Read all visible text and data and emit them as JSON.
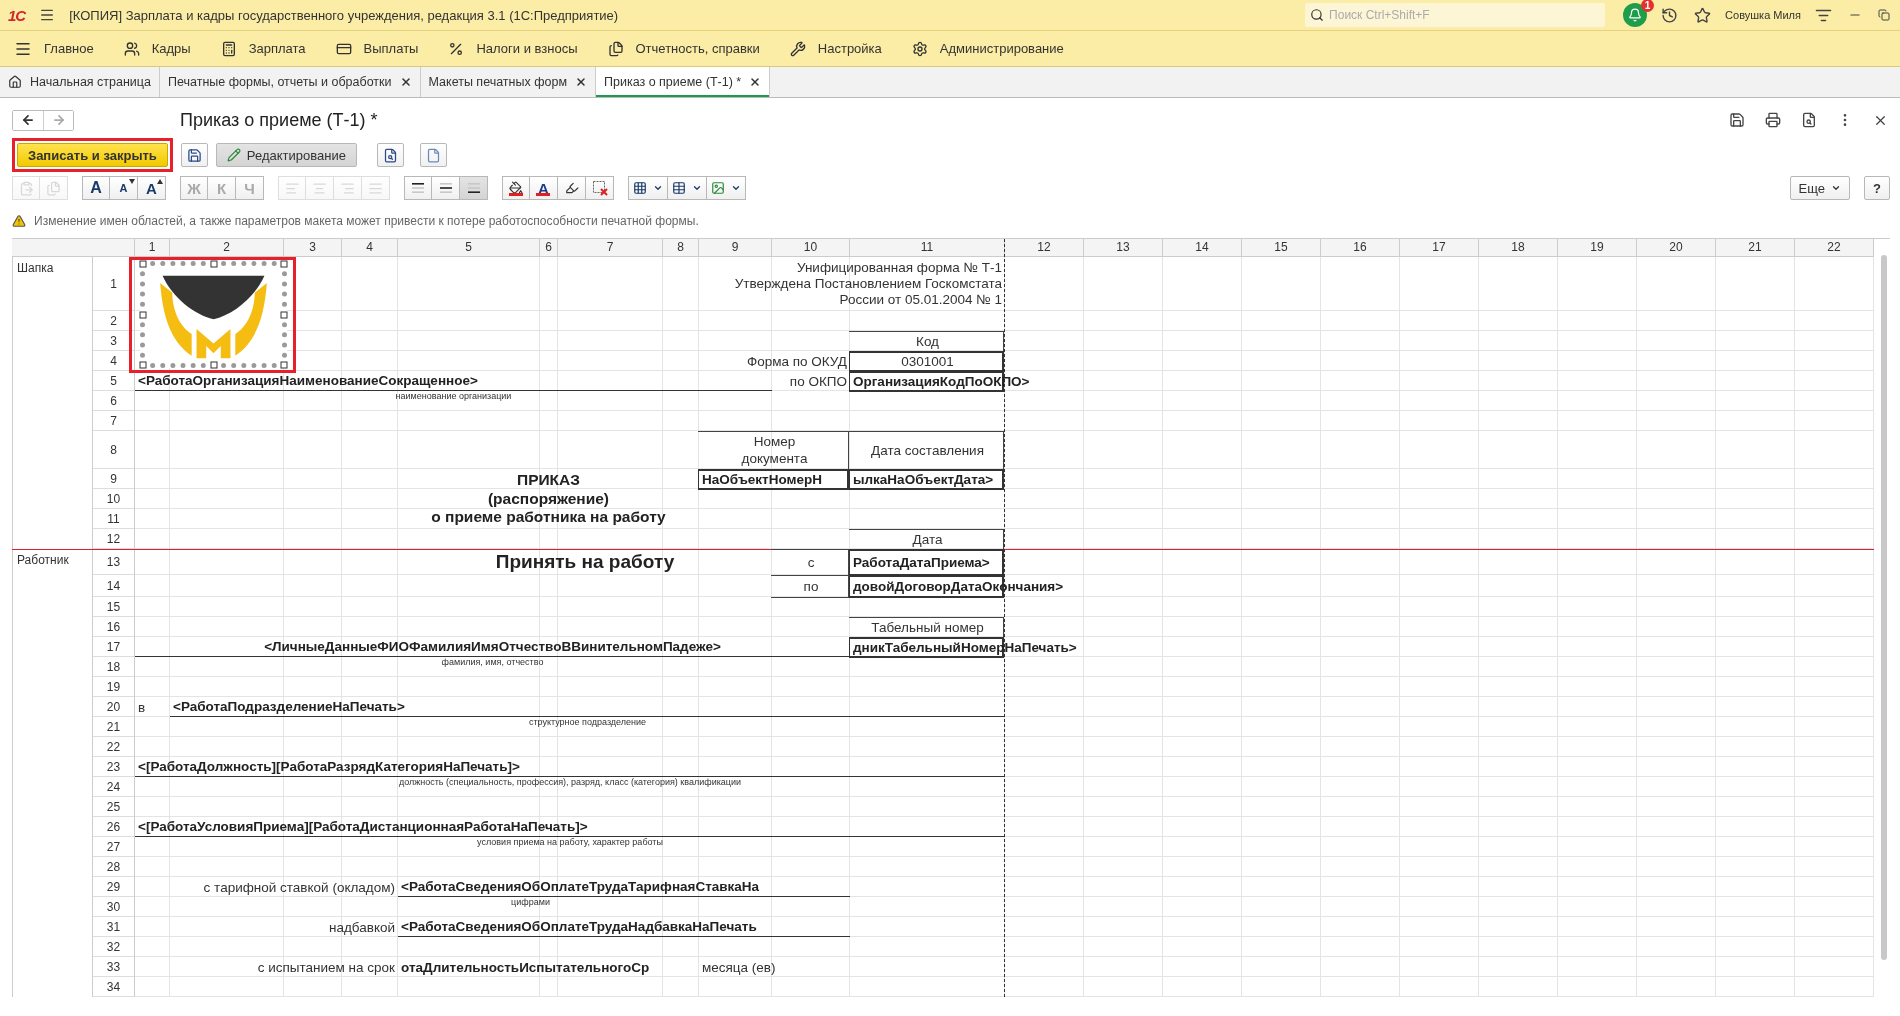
{
  "title_bar": {
    "logo": "1С",
    "title": "[КОПИЯ] Зарплата и кадры государственного учреждения, редакция 3.1  (1С:Предприятие)",
    "search_placeholder": "Поиск Ctrl+Shift+F",
    "notification_count": "1",
    "user": "Совушка Миля"
  },
  "sections": [
    {
      "label": "Главное"
    },
    {
      "label": "Кадры"
    },
    {
      "label": "Зарплата"
    },
    {
      "label": "Выплаты"
    },
    {
      "label": "Налоги и взносы"
    },
    {
      "label": "Отчетность, справки"
    },
    {
      "label": "Настройка"
    },
    {
      "label": "Администрирование"
    }
  ],
  "tabs": [
    {
      "label": "Начальная страница",
      "selected": false,
      "closable": false
    },
    {
      "label": "Печатные формы, отчеты и обработки",
      "selected": false,
      "closable": true
    },
    {
      "label": "Макеты печатных форм",
      "selected": false,
      "closable": true
    },
    {
      "label": "Приказ о приеме (Т-1) *",
      "selected": true,
      "closable": true
    }
  ],
  "form": {
    "title": "Приказ о приеме (Т-1) *",
    "nav_buttons": [
      {
        "disabled": false
      },
      {
        "disabled": true
      }
    ]
  },
  "commands": {
    "primary": "Записать и закрыть",
    "primary_highlighted": true,
    "edit_toggle": {
      "label": "Редактирование",
      "selected": true
    }
  },
  "format_toolbar": [
    [
      {
        "disabled": true
      },
      {
        "disabled": true
      }
    ],
    [
      {
        "glyph": "A",
        "disabled": false
      },
      {
        "glyph": "A",
        "disabled": false
      },
      {
        "glyph": "A",
        "disabled": false
      }
    ],
    [
      {
        "glyph": "Ж",
        "disabled": true
      },
      {
        "glyph": "К",
        "disabled": true
      },
      {
        "glyph": "Ч",
        "disabled": true
      }
    ],
    [
      {
        "disabled": true
      },
      {
        "disabled": true
      },
      {
        "disabled": true
      },
      {
        "disabled": true
      }
    ],
    [
      {
        "selected": false
      },
      {
        "selected": false
      },
      {
        "selected": true
      }
    ],
    [
      {
        "disabled": false
      },
      {
        "glyph": "A",
        "disabled": false
      },
      {
        "disabled": false
      },
      {
        "disabled": false
      }
    ],
    [
      {
        "dropdown": true
      },
      {
        "dropdown": true
      },
      {
        "dropdown": true
      }
    ]
  ],
  "more_button": "Еще",
  "help_button": "?",
  "warning": "Изменение имен областей, а также параметров макета может привести к потере работоспособности печатной формы.",
  "sheet": {
    "columns": [
      "1",
      "2",
      "3",
      "4",
      "5",
      "6",
      "7",
      "8",
      "9",
      "10",
      "11",
      "12",
      "13",
      "14",
      "15",
      "16",
      "17",
      "18",
      "19",
      "20",
      "21",
      "22"
    ],
    "rows": [
      "1",
      "2",
      "3",
      "4",
      "5",
      "6",
      "7",
      "8",
      "9",
      "10",
      "11",
      "12",
      "13",
      "14",
      "15",
      "16",
      "17",
      "18",
      "19",
      "20",
      "21",
      "22",
      "23",
      "24",
      "25",
      "26",
      "27",
      "28",
      "29",
      "30",
      "31",
      "32",
      "33",
      "34"
    ],
    "areas": [
      {
        "name": "Шапка"
      },
      {
        "name": "Работник"
      }
    ],
    "image": {
      "selected": true,
      "highlighted": true
    },
    "cells": [
      {
        "kind": "text",
        "lines": [
          "Унифицированная форма № Т-1",
          "Утверждена Постановлением Госкомстата",
          "России от 05.01.2004 № 1"
        ]
      },
      {
        "kind": "text",
        "text": "Код"
      },
      {
        "kind": "text",
        "text": "Форма по ОКУД"
      },
      {
        "kind": "text",
        "text": "0301001"
      },
      {
        "kind": "field",
        "underline": true,
        "text": "<РаботаОрганизацияНаименованиеСокращенное>"
      },
      {
        "kind": "text",
        "text": "по ОКПО"
      },
      {
        "kind": "field",
        "text": "ОрганизацияКодПоОКПО>"
      },
      {
        "kind": "caption",
        "text": "наименование организации"
      },
      {
        "kind": "text",
        "lines": [
          "Номер",
          "документа"
        ]
      },
      {
        "kind": "text",
        "text": "Дата составления"
      },
      {
        "kind": "heading",
        "lines": [
          "ПРИКАЗ",
          "(распоряжение)",
          "о приеме работника на работу"
        ]
      },
      {
        "kind": "field",
        "text": "НаОбъектНомерН"
      },
      {
        "kind": "field",
        "text": "ылкаНаОбъектДата>"
      },
      {
        "kind": "text",
        "text": "Дата"
      },
      {
        "kind": "big",
        "text": "Принять на работу"
      },
      {
        "kind": "text",
        "text": "с"
      },
      {
        "kind": "field",
        "text": "РаботаДатаПриема>"
      },
      {
        "kind": "text",
        "text": "по"
      },
      {
        "kind": "field",
        "text": "довойДоговорДатаОкончания>"
      },
      {
        "kind": "text",
        "text": "Табельный номер"
      },
      {
        "kind": "field",
        "underline": true,
        "text": "<ЛичныеДанныеФИОФамилияИмяОтчествоВВинительномПадеже>"
      },
      {
        "kind": "field",
        "text": "дникТабельныйНомерНаПечать>"
      },
      {
        "kind": "caption",
        "text": "фамилия, имя, отчество"
      },
      {
        "kind": "text",
        "text": "в"
      },
      {
        "kind": "field",
        "underline": true,
        "text": "<РаботаПодразделениеНаПечать>"
      },
      {
        "kind": "caption",
        "text": "структурное подразделение"
      },
      {
        "kind": "field",
        "underline": true,
        "text": "<[РаботаДолжность][РаботаРазрядКатегорияНаПечать]>"
      },
      {
        "kind": "caption",
        "text": "должность (специальность, профессия), разряд, класс (категория) квалификации"
      },
      {
        "kind": "field",
        "underline": true,
        "text": "<[РаботаУсловияПриема][РаботаДистанционнаяРаботаНаПечать]>"
      },
      {
        "kind": "caption",
        "text": "условия приема на работу, характер работы"
      },
      {
        "kind": "text",
        "text": "с тарифной ставкой (окладом)"
      },
      {
        "kind": "field",
        "underline": true,
        "text": "<РаботаСведенияОбОплатеТрудаТарифнаяСтавкаНа"
      },
      {
        "kind": "caption",
        "text": "цифрами"
      },
      {
        "kind": "text",
        "text": "надбавкой"
      },
      {
        "kind": "field",
        "underline": true,
        "text": "<РаботаСведенияОбОплатеТрудаНадбавкаНаПечать"
      },
      {
        "kind": "text",
        "text": "с испытанием на срок"
      },
      {
        "kind": "field",
        "text": "отаДлительностьИспытательногоСр"
      },
      {
        "kind": "text",
        "text": "месяца (ев)"
      }
    ]
  }
}
